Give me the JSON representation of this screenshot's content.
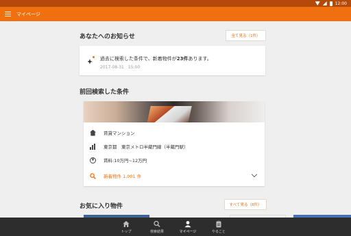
{
  "statusbar": {
    "time": "12:00"
  },
  "appbar": {
    "title": "マイページ"
  },
  "notice": {
    "title": "あなたへのお知らせ",
    "view_all": "全て見る（1件）",
    "text_before": "過去に検索した条件で、新着物件が",
    "count": "23件",
    "text_after": "あります。",
    "date": "2017-08-31　15:00"
  },
  "last_search": {
    "title": "前回検索した条件",
    "property_type": "賃貸マンション",
    "location": "東京都　東京メトロ半蔵門線（半蔵門駅）",
    "rent": "賃料:10万円~12万円",
    "new_count": "新着物件 1,001 件"
  },
  "favorites": {
    "title": "お気に入り物件",
    "view_all": "すべて見る（8件）"
  },
  "bottom_nav": [
    {
      "label": "トップ",
      "icon": "home-icon"
    },
    {
      "label": "検索結果",
      "icon": "search-results-icon"
    },
    {
      "label": "マイページ",
      "icon": "person-icon"
    },
    {
      "label": "やること",
      "icon": "clipboard-icon"
    }
  ],
  "colors": {
    "accent": "#f07010",
    "statusbar": "#b44a0a",
    "background": "#efefef",
    "nav": "#2d2d2d"
  }
}
